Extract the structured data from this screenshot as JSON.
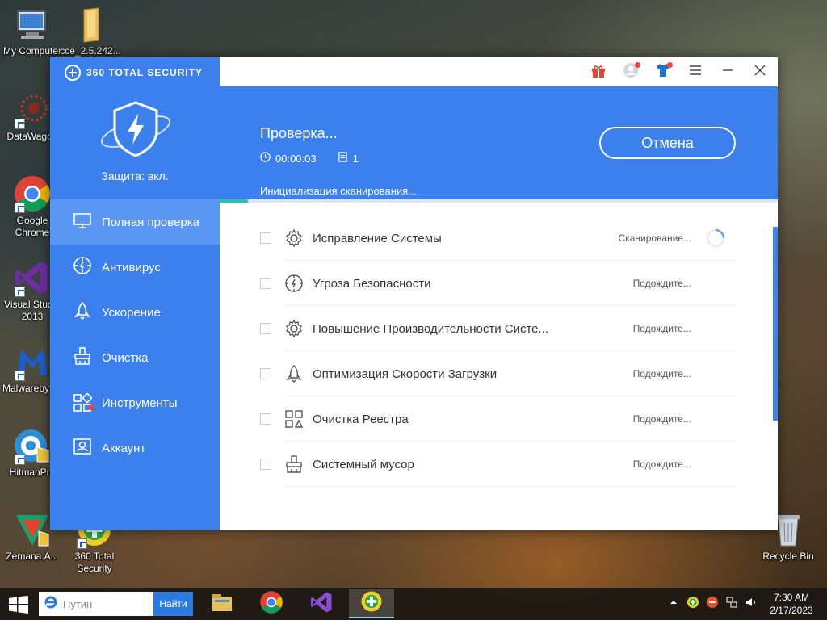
{
  "desktop": {
    "icons": [
      {
        "label": "My Computer",
        "icon": "computer-icon"
      },
      {
        "label": "cce_2.5.242...",
        "icon": "folder-icon"
      },
      {
        "label": "DataWagon",
        "icon": "datawagon-icon"
      },
      {
        "label": "Google Chrome",
        "icon": "chrome-icon"
      },
      {
        "label": "Visual Studio 2013",
        "icon": "visual-studio-icon"
      },
      {
        "label": "Malwarebytes",
        "icon": "malwarebytes-icon"
      },
      {
        "label": "HitmanPro",
        "icon": "hitmanpro-icon"
      },
      {
        "label": "Zemana.A...",
        "icon": "zemana-icon"
      },
      {
        "label": "360 Total Security",
        "icon": "360-total-security-icon"
      },
      {
        "label": "Recycle Bin",
        "icon": "recycle-bin-icon"
      }
    ]
  },
  "app": {
    "brand": "360 TOTAL SECURITY",
    "protection_status": "Защита: вкл.",
    "nav": [
      {
        "label": "Полная проверка",
        "icon": "monitor-icon",
        "active": true
      },
      {
        "label": "Антивирус",
        "icon": "antivirus-icon"
      },
      {
        "label": "Ускорение",
        "icon": "rocket-icon"
      },
      {
        "label": "Очистка",
        "icon": "broom-icon"
      },
      {
        "label": "Инструменты",
        "icon": "tools-icon",
        "badge": true
      },
      {
        "label": "Аккаунт",
        "icon": "account-icon"
      }
    ],
    "titlebar": {
      "buttons": [
        "gift-icon",
        "avatar-icon",
        "skin-shirt-icon",
        "menu-icon",
        "minimize-icon",
        "close-icon"
      ]
    },
    "scan": {
      "title": "Проверка...",
      "elapsed": "00:00:03",
      "items_scanned": "1",
      "stage": "Инициализация сканирования...",
      "cancel_label": "Отмена",
      "progress": 0.05
    },
    "checks": [
      {
        "label": "Исправление Системы",
        "status": "Сканирование...",
        "icon": "gear-icon",
        "spinning": true
      },
      {
        "label": "Угроза Безопасности",
        "status": "Подождите...",
        "icon": "compass-shield-icon"
      },
      {
        "label": "Повышение Производительности Систе...",
        "status": "Подождите...",
        "icon": "gear-icon"
      },
      {
        "label": "Оптимизация Скорости Загрузки",
        "status": "Подождите...",
        "icon": "rocket-icon"
      },
      {
        "label": "Очистка Реестра",
        "status": "Подождите...",
        "icon": "registry-icon"
      },
      {
        "label": "Системный мусор",
        "status": "Подождите...",
        "icon": "trash-broom-icon"
      }
    ]
  },
  "taskbar": {
    "search_placeholder": "Путин",
    "search_button": "Найти",
    "apps": [
      "file-explorer-icon",
      "chrome-icon",
      "visual-studio-icon",
      "360-total-security-icon"
    ],
    "clock_time": "7:30 AM",
    "clock_date": "2/17/2023"
  },
  "colors": {
    "brand_blue": "#3b80ec",
    "active_nav": "#5a97f2",
    "progress": "#29c5a6",
    "badge_red": "#f0433a"
  }
}
